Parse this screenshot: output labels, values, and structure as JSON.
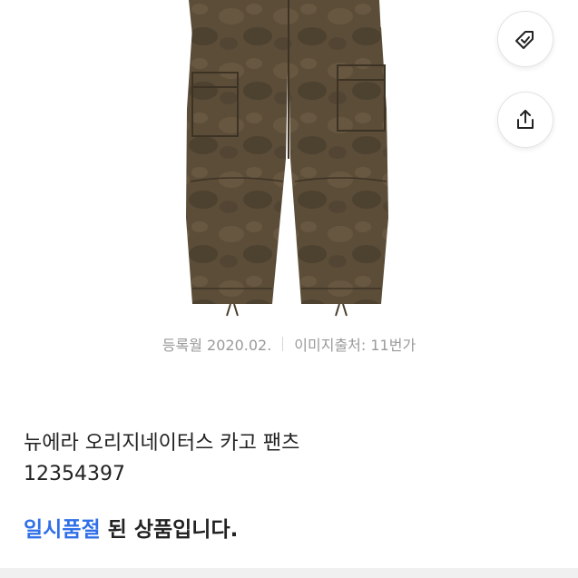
{
  "product": {
    "image_alt": "product-photo",
    "registered": "등록월 2020.02.",
    "image_source": "이미지출처: 11번가",
    "name": "뉴에라 오리지네이터스 카고 팬츠",
    "code": "12354397",
    "sold_out_highlight": "일시품절",
    "sold_out_rest": " 된 상품입니다."
  },
  "actions": {
    "wish_icon": "heart-tag-icon",
    "share_icon": "share-icon"
  },
  "colors": {
    "accent": "#2f6fe8",
    "pants": "#5a4c37"
  }
}
